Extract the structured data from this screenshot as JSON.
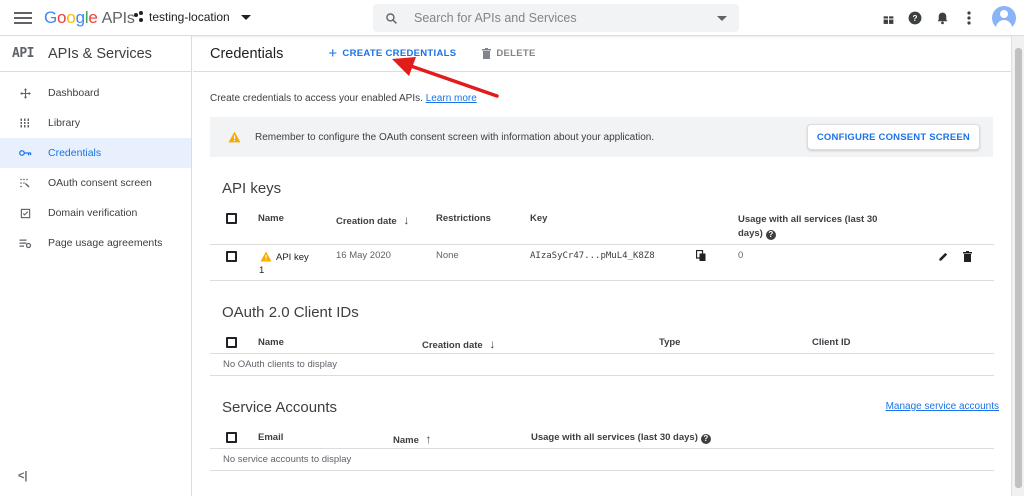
{
  "topbar": {
    "logo_letters": [
      "G",
      "o",
      "o",
      "g",
      "l",
      "e"
    ],
    "logo_suffix": "APIs",
    "project_name": "testing-location",
    "search_placeholder": "Search for APIs and Services"
  },
  "sidebar": {
    "badge": "API",
    "title": "APIs & Services",
    "items": [
      {
        "label": "Dashboard",
        "icon": "dashboard-icon"
      },
      {
        "label": "Library",
        "icon": "library-icon"
      },
      {
        "label": "Credentials",
        "icon": "key-icon",
        "active": true
      },
      {
        "label": "OAuth consent screen",
        "icon": "consent-icon"
      },
      {
        "label": "Domain verification",
        "icon": "domain-icon"
      },
      {
        "label": "Page usage agreements",
        "icon": "settings-list-icon"
      }
    ],
    "collapse_label": "<|"
  },
  "page": {
    "title": "Credentials",
    "create_label": "CREATE CREDENTIALS",
    "delete_label": "DELETE",
    "intro_text": "Create credentials to access your enabled APIs.",
    "learn_more": "Learn more",
    "banner_text": "Remember to configure the OAuth consent screen with information about your application.",
    "banner_button": "CONFIGURE CONSENT SCREEN"
  },
  "api_keys": {
    "title": "API keys",
    "headers": {
      "name": "Name",
      "created": "Creation date",
      "restrictions": "Restrictions",
      "key": "Key",
      "usage_line1": "Usage with all services (last 30",
      "usage_line2": "days)"
    },
    "rows": [
      {
        "name_line1": "API key",
        "name_line2": "1",
        "created": "16 May 2020",
        "restrictions": "None",
        "key": "AIzaSyCr47...pMuL4_K8Z8",
        "usage": "0"
      }
    ]
  },
  "oauth": {
    "title": "OAuth 2.0 Client IDs",
    "headers": {
      "name": "Name",
      "created": "Creation date",
      "type": "Type",
      "client_id": "Client ID"
    },
    "empty": "No OAuth clients to display"
  },
  "service_accounts": {
    "title": "Service Accounts",
    "manage_link": "Manage service accounts",
    "headers": {
      "email": "Email",
      "name": "Name",
      "usage": "Usage with all services (last 30 days)"
    },
    "empty": "No service accounts to display"
  },
  "colors": {
    "accent": "#1a73e8",
    "warning": "#f9ab00",
    "annotation_arrow": "#e21b1b"
  }
}
